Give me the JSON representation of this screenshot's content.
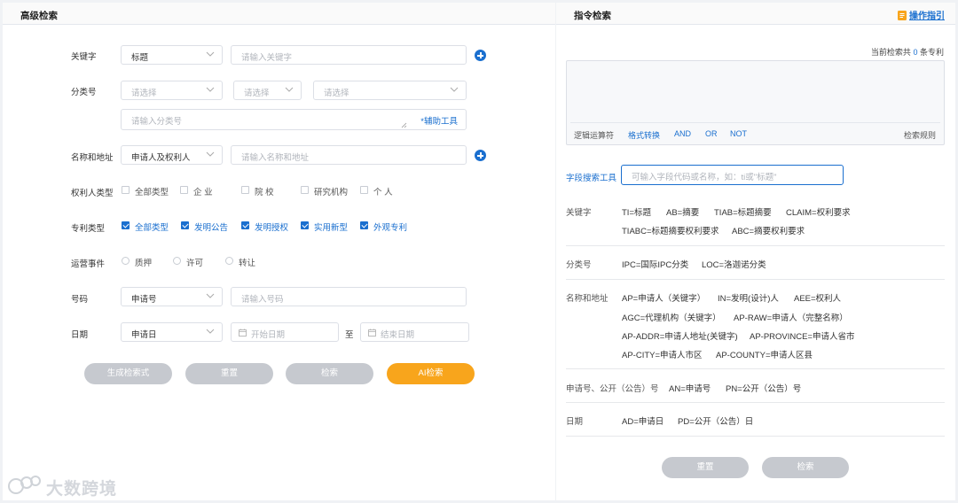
{
  "left": {
    "title": "高级检索",
    "keyword": {
      "label": "关键字",
      "select": "标题",
      "placeholder": "请输入关键字"
    },
    "classification": {
      "label": "分类号",
      "select1": "请选择",
      "select2": "请选择",
      "select3": "请选择",
      "textarea_placeholder": "请输入分类号",
      "helper": "*辅助工具"
    },
    "name_address": {
      "label": "名称和地址",
      "select": "申请人及权利人",
      "placeholder": "请输入名称和地址"
    },
    "owner_type": {
      "label": "权利人类型",
      "options": [
        "全部类型",
        "企 业",
        "院 校",
        "研究机构",
        "个 人"
      ]
    },
    "patent_type": {
      "label": "专利类型",
      "options": [
        "全部类型",
        "发明公告",
        "发明授权",
        "实用新型",
        "外观专利"
      ]
    },
    "operation": {
      "label": "运营事件",
      "options": [
        "质押",
        "许可",
        "转让"
      ]
    },
    "number": {
      "label": "号码",
      "select": "申请号",
      "placeholder": "请输入号码"
    },
    "date": {
      "label": "日期",
      "select": "申请日",
      "start_placeholder": "开始日期",
      "to": "至",
      "end_placeholder": "结束日期"
    },
    "buttons": {
      "generate": "生成检索式",
      "reset": "重置",
      "search": "检索",
      "ai": "AI检索"
    }
  },
  "right": {
    "title": "指令检索",
    "guide": "操作指引",
    "count_prefix": "当前检索共",
    "count": "0",
    "count_suffix": "条专利",
    "toolbar": {
      "logic": "逻辑运算符",
      "format": "格式转换",
      "and": "AND",
      "or": "OR",
      "not": "NOT",
      "rules": "检索规则"
    },
    "field_tool": {
      "label": "字段搜索工具",
      "placeholder": "可输入字段代码或名称，如：ti或\"标题\""
    },
    "keyword": {
      "label": "关键字",
      "line1": [
        "TI=标题",
        "AB=摘要",
        "TIAB=标题摘要",
        "CLAIM=权利要求"
      ],
      "line2": [
        "TIABC=标题摘要权利要求",
        "ABC=摘要权利要求"
      ]
    },
    "classification": {
      "label": "分类号",
      "items": [
        "IPC=国际IPC分类",
        "LOC=洛迦诺分类"
      ]
    },
    "name_address": {
      "label": "名称和地址",
      "line1": [
        "AP=申请人（关键字）",
        "IN=发明(设计)人",
        "AEE=权利人"
      ],
      "line2": [
        "AGC=代理机构（关键字）",
        "AP-RAW=申请人（完整名称）"
      ],
      "line3": [
        "AP-ADDR=申请人地址(关键字)",
        "AP-PROVINCE=申请人省市"
      ],
      "line4": [
        "AP-CITY=申请人市区",
        "AP-COUNTY=申请人区县"
      ]
    },
    "number": {
      "label": "申请号、公开（公告）号",
      "items": [
        "AN=申请号",
        "PN=公开（公告）号"
      ]
    },
    "date": {
      "label": "日期",
      "items": [
        "AD=申请日",
        "PD=公开（公告）日"
      ]
    },
    "buttons": {
      "reset": "重置",
      "search": "检索"
    }
  },
  "watermark": "大数跨境",
  "colors": {
    "accent": "#1a6fcf",
    "orange": "#f8a51c",
    "disabled": "#c6c9cf"
  }
}
